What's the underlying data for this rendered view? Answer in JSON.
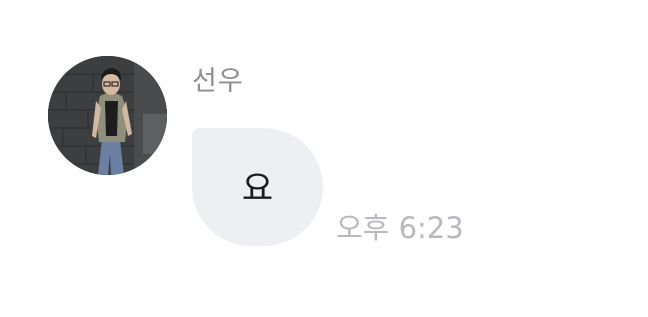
{
  "chat": {
    "message": {
      "sender_name": "선우",
      "text": "요",
      "time": "오후 6:23",
      "avatar": "user-profile-photo"
    }
  },
  "colors": {
    "background": "#ffffff",
    "bubble": "#eeeff3",
    "sender_name": "#8e8e93",
    "message_text": "#1c1c1e",
    "timestamp": "#b8b8be"
  }
}
